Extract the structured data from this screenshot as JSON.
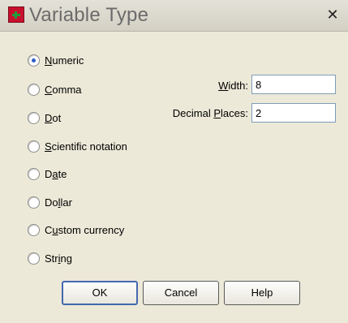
{
  "window": {
    "title": "Variable Type",
    "close_glyph": "✕"
  },
  "options": [
    {
      "pre": "",
      "u": "N",
      "post": "umeric",
      "checked": true
    },
    {
      "pre": "",
      "u": "C",
      "post": "omma",
      "checked": false
    },
    {
      "pre": "",
      "u": "D",
      "post": "ot",
      "checked": false
    },
    {
      "pre": "",
      "u": "S",
      "post": "cientific notation",
      "checked": false
    },
    {
      "pre": "D",
      "u": "a",
      "post": "te",
      "checked": false
    },
    {
      "pre": "Do",
      "u": "l",
      "post": "lar",
      "checked": false
    },
    {
      "pre": "C",
      "u": "u",
      "post": "stom currency",
      "checked": false
    },
    {
      "pre": "Str",
      "u": "i",
      "post": "ng",
      "checked": false
    }
  ],
  "fields": {
    "width": {
      "pre": "",
      "u": "W",
      "post": "idth:",
      "value": "8"
    },
    "decimal": {
      "pre": "Decimal ",
      "u": "P",
      "post": "laces:",
      "value": "2"
    }
  },
  "buttons": {
    "ok": "OK",
    "cancel": "Cancel",
    "help": "Help"
  }
}
